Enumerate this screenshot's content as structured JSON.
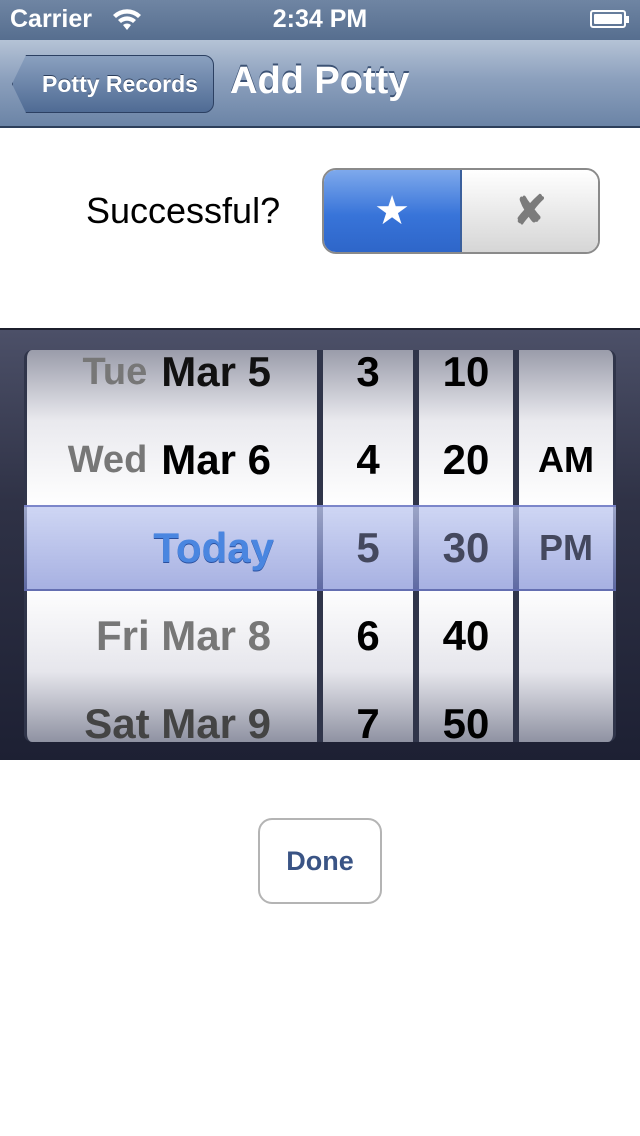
{
  "status_bar": {
    "carrier": "Carrier",
    "time": "2:34 PM",
    "icons": [
      "wifi-icon",
      "battery-icon"
    ]
  },
  "nav": {
    "back_label": "Potty Records",
    "title": "Add Potty"
  },
  "form": {
    "successful_label": "Successful?",
    "segments": [
      {
        "label": "★",
        "icon": "star-icon",
        "selected": true
      },
      {
        "label": "✘",
        "icon": "x-icon",
        "selected": false
      }
    ]
  },
  "picker": {
    "dates": [
      {
        "day": "Tue",
        "date": "Mar 5"
      },
      {
        "day": "Wed",
        "date": "Mar 6"
      },
      {
        "day": "",
        "date": "Today"
      },
      {
        "day": "",
        "date": "Fri Mar 8"
      },
      {
        "day": "",
        "date": "Sat Mar 9"
      }
    ],
    "hours": [
      "3",
      "4",
      "5",
      "6",
      "7"
    ],
    "minutes": [
      "10",
      "20",
      "30",
      "40",
      "50"
    ],
    "ampm": [
      "",
      "AM",
      "PM",
      "",
      ""
    ],
    "selected": {
      "date": "Today",
      "hour": "5",
      "minute": "30",
      "ampm": "PM"
    }
  },
  "actions": {
    "done_label": "Done"
  },
  "colors": {
    "accent": "#4a86e0",
    "nav_bar": "#6b84a6",
    "done_text": "#3a5485"
  }
}
